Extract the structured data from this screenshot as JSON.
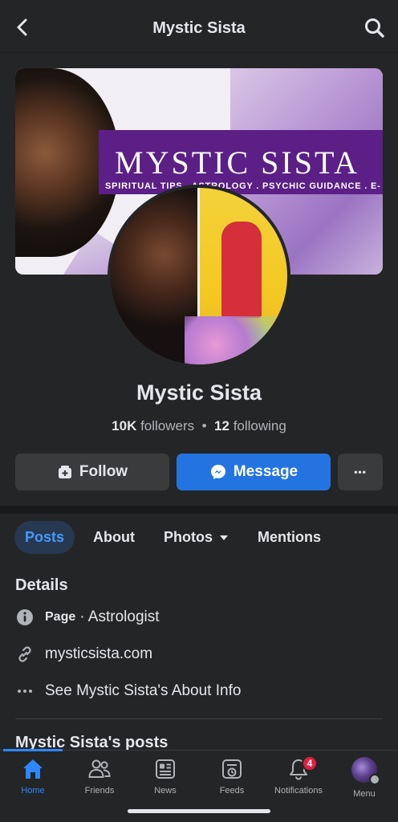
{
  "header": {
    "title": "Mystic Sista"
  },
  "cover": {
    "name": "MYSTIC SISTA",
    "tagline": "SPIRITUAL TIPS . ASTROLOGY . PSYCHIC GUIDANCE . E-"
  },
  "profile": {
    "name": "Mystic Sista",
    "followers_count": "10K",
    "followers_label": "followers",
    "separator": "•",
    "following_count": "12",
    "following_label": "following"
  },
  "actions": {
    "follow": "Follow",
    "message": "Message",
    "more": "•••"
  },
  "tabs": [
    {
      "label": "Posts"
    },
    {
      "label": "About"
    },
    {
      "label": "Photos"
    },
    {
      "label": "Mentions"
    }
  ],
  "details": {
    "title": "Details",
    "category_label": "Page",
    "category_value": "· Astrologist",
    "website": "mysticsista.com",
    "about_link": "See Mystic Sista's About Info"
  },
  "posts_section": {
    "title": "Mystic Sista's posts"
  },
  "bottom_nav": [
    {
      "label": "Home",
      "icon": "home-icon"
    },
    {
      "label": "Friends",
      "icon": "friends-icon"
    },
    {
      "label": "News",
      "icon": "news-icon"
    },
    {
      "label": "Feeds",
      "icon": "feeds-icon"
    },
    {
      "label": "Notifications",
      "icon": "bell-icon",
      "badge": "4"
    },
    {
      "label": "Menu",
      "icon": "menu-avatar"
    }
  ],
  "colors": {
    "accent": "#2374e1",
    "background": "#242526",
    "badge": "#e41e3f",
    "cover_band": "#5b1f86"
  }
}
